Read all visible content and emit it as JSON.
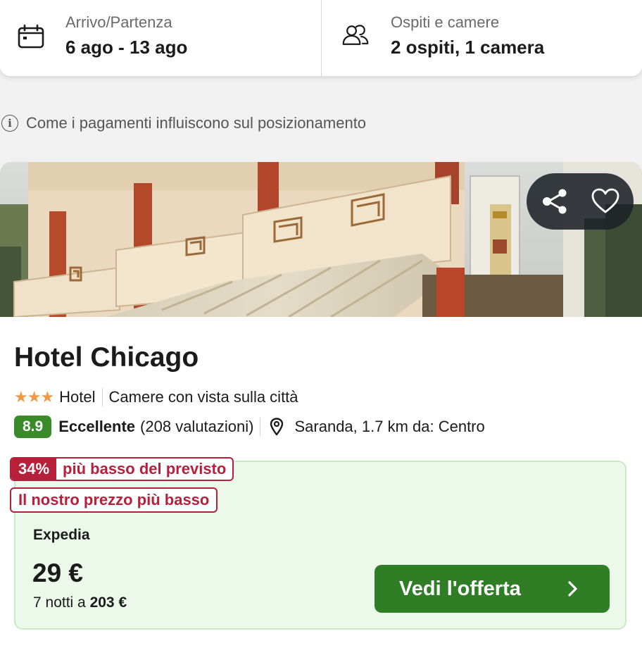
{
  "search_bar": {
    "dates": {
      "label": "Arrivo/Partenza",
      "value": "6 ago - 13 ago",
      "icon": "calendar-icon"
    },
    "guests": {
      "label": "Ospiti e camere",
      "value": "2 ospiti, 1 camera",
      "icon": "users-icon"
    }
  },
  "payment_note": {
    "text": "Come i pagamenti influiscono sul posizionamento",
    "icon": "info-icon"
  },
  "hotel": {
    "photo_icons": [
      "share-icon",
      "heart-icon"
    ],
    "name": "Hotel Chicago",
    "stars": "★★★",
    "star_count": 3,
    "type": "Hotel",
    "feature": "Camere con vista sulla città",
    "score": "8.9",
    "rating_word": "Eccellente",
    "reviews": "(208 valutazioni)",
    "location": "Saranda, 1.7 km da: Centro"
  },
  "deal": {
    "percent": "34%",
    "percent_text": "più basso del previsto",
    "lowest_text": "Il nostro prezzo più basso",
    "provider": "Expedia",
    "price": "29 €",
    "total_prefix": "7 notti a",
    "total_value": "203 €",
    "cta_label": "Vedi l'offerta"
  },
  "colors": {
    "score_green": "#3a8a2a",
    "cta_green": "#2f7d25",
    "deal_red": "#b6203a",
    "star_orange": "#f29a40",
    "offer_bg": "#ebf8ea"
  }
}
